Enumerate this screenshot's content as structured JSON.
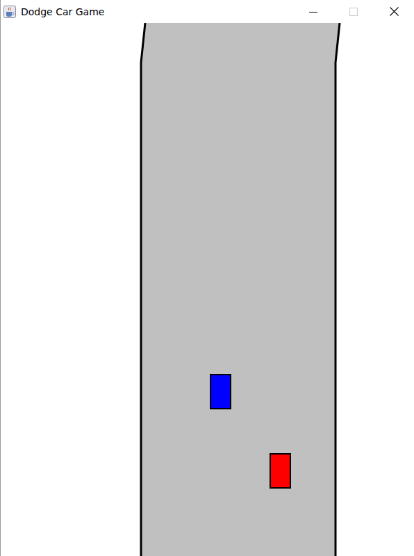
{
  "window": {
    "title": "Dodge Car Game",
    "maximize_disabled": true
  },
  "cars": [
    {
      "color": "#0000ff"
    },
    {
      "color": "#ff0000"
    }
  ]
}
